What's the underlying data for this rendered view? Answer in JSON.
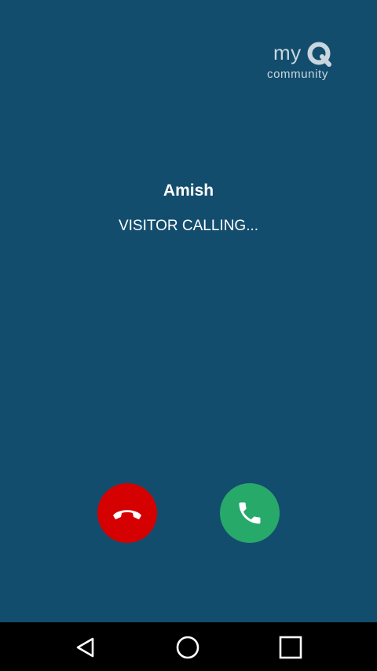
{
  "logo": {
    "brand_prefix": "my",
    "brand_letter": "Q",
    "brand_suffix": "community"
  },
  "call": {
    "caller_name": "Amish",
    "status": "VISITOR CALLING..."
  },
  "actions": {
    "decline_icon": "call-end-icon",
    "accept_icon": "phone-icon",
    "decline_color": "#d50000",
    "accept_color": "#27a96a"
  },
  "navbar": {
    "back_icon": "back-triangle-icon",
    "home_icon": "home-circle-icon",
    "recent_icon": "recent-apps-square-icon"
  },
  "colors": {
    "background": "#134d6d",
    "navbar": "#000000",
    "text": "#ffffff"
  }
}
